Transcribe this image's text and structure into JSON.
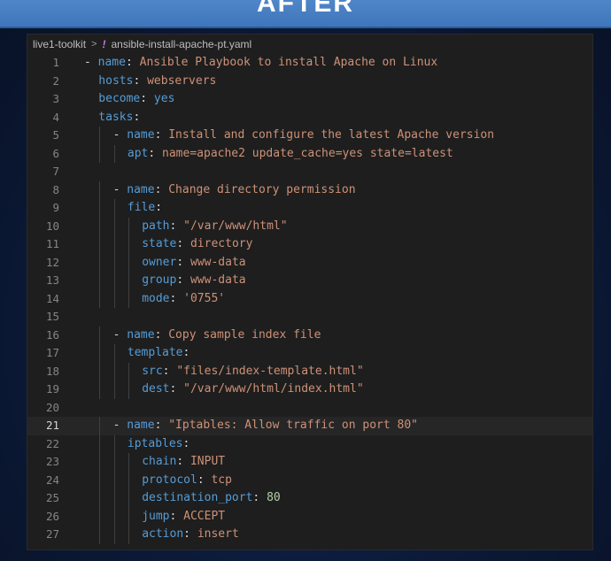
{
  "banner": {
    "title": "AFTER"
  },
  "breadcrumb": {
    "folder": "live1-toolkit",
    "separator": ">",
    "file_icon": "!",
    "file": "ansible-install-apache-pt.yaml"
  },
  "editor": {
    "active_line": 21,
    "lines": [
      {
        "n": "1",
        "indent": 0,
        "segs": [
          {
            "c": "d",
            "t": "- "
          },
          {
            "c": "k",
            "t": "name"
          },
          {
            "c": "p",
            "t": ": "
          },
          {
            "c": "v",
            "t": "Ansible Playbook to install Apache on Linux"
          }
        ]
      },
      {
        "n": "2",
        "indent": 1,
        "segs": [
          {
            "c": "k",
            "t": "hosts"
          },
          {
            "c": "p",
            "t": ": "
          },
          {
            "c": "v",
            "t": "webservers"
          }
        ]
      },
      {
        "n": "3",
        "indent": 1,
        "segs": [
          {
            "c": "k",
            "t": "become"
          },
          {
            "c": "p",
            "t": ": "
          },
          {
            "c": "k",
            "t": "yes"
          }
        ]
      },
      {
        "n": "4",
        "indent": 1,
        "segs": [
          {
            "c": "k",
            "t": "tasks"
          },
          {
            "c": "p",
            "t": ":"
          }
        ]
      },
      {
        "n": "5",
        "indent": 2,
        "segs": [
          {
            "c": "d",
            "t": "- "
          },
          {
            "c": "k",
            "t": "name"
          },
          {
            "c": "p",
            "t": ": "
          },
          {
            "c": "v",
            "t": "Install and configure the latest Apache version"
          }
        ]
      },
      {
        "n": "6",
        "indent": 3,
        "segs": [
          {
            "c": "k",
            "t": "apt"
          },
          {
            "c": "p",
            "t": ": "
          },
          {
            "c": "v",
            "t": "name=apache2 update_cache=yes state=latest"
          }
        ]
      },
      {
        "n": "7",
        "indent": 0,
        "segs": []
      },
      {
        "n": "8",
        "indent": 2,
        "segs": [
          {
            "c": "d",
            "t": "- "
          },
          {
            "c": "k",
            "t": "name"
          },
          {
            "c": "p",
            "t": ": "
          },
          {
            "c": "v",
            "t": "Change directory permission"
          }
        ]
      },
      {
        "n": "9",
        "indent": 3,
        "segs": [
          {
            "c": "k",
            "t": "file"
          },
          {
            "c": "p",
            "t": ":"
          }
        ]
      },
      {
        "n": "10",
        "indent": 4,
        "segs": [
          {
            "c": "k",
            "t": "path"
          },
          {
            "c": "p",
            "t": ": "
          },
          {
            "c": "v",
            "t": "\"/var/www/html\""
          }
        ]
      },
      {
        "n": "11",
        "indent": 4,
        "segs": [
          {
            "c": "k",
            "t": "state"
          },
          {
            "c": "p",
            "t": ": "
          },
          {
            "c": "v",
            "t": "directory"
          }
        ]
      },
      {
        "n": "12",
        "indent": 4,
        "segs": [
          {
            "c": "k",
            "t": "owner"
          },
          {
            "c": "p",
            "t": ": "
          },
          {
            "c": "v",
            "t": "www-data"
          }
        ]
      },
      {
        "n": "13",
        "indent": 4,
        "segs": [
          {
            "c": "k",
            "t": "group"
          },
          {
            "c": "p",
            "t": ": "
          },
          {
            "c": "v",
            "t": "www-data"
          }
        ]
      },
      {
        "n": "14",
        "indent": 4,
        "segs": [
          {
            "c": "k",
            "t": "mode"
          },
          {
            "c": "p",
            "t": ": "
          },
          {
            "c": "v",
            "t": "'0755'"
          }
        ]
      },
      {
        "n": "15",
        "indent": 0,
        "segs": []
      },
      {
        "n": "16",
        "indent": 2,
        "segs": [
          {
            "c": "d",
            "t": "- "
          },
          {
            "c": "k",
            "t": "name"
          },
          {
            "c": "p",
            "t": ": "
          },
          {
            "c": "v",
            "t": "Copy sample index file"
          }
        ]
      },
      {
        "n": "17",
        "indent": 3,
        "segs": [
          {
            "c": "k",
            "t": "template"
          },
          {
            "c": "p",
            "t": ":"
          }
        ]
      },
      {
        "n": "18",
        "indent": 4,
        "segs": [
          {
            "c": "k",
            "t": "src"
          },
          {
            "c": "p",
            "t": ": "
          },
          {
            "c": "v",
            "t": "\"files/index-template.html\""
          }
        ]
      },
      {
        "n": "19",
        "indent": 4,
        "segs": [
          {
            "c": "k",
            "t": "dest"
          },
          {
            "c": "p",
            "t": ": "
          },
          {
            "c": "v",
            "t": "\"/var/www/html/index.html\""
          }
        ]
      },
      {
        "n": "20",
        "indent": 0,
        "segs": []
      },
      {
        "n": "21",
        "indent": 2,
        "segs": [
          {
            "c": "d",
            "t": "- "
          },
          {
            "c": "k",
            "t": "name"
          },
          {
            "c": "p",
            "t": ": "
          },
          {
            "c": "v",
            "t": "\"Iptables: Allow traffic on port 80\""
          }
        ]
      },
      {
        "n": "22",
        "indent": 3,
        "segs": [
          {
            "c": "k",
            "t": "iptables"
          },
          {
            "c": "p",
            "t": ":"
          }
        ]
      },
      {
        "n": "23",
        "indent": 4,
        "segs": [
          {
            "c": "k",
            "t": "chain"
          },
          {
            "c": "p",
            "t": ": "
          },
          {
            "c": "v",
            "t": "INPUT"
          }
        ]
      },
      {
        "n": "24",
        "indent": 4,
        "segs": [
          {
            "c": "k",
            "t": "protocol"
          },
          {
            "c": "p",
            "t": ": "
          },
          {
            "c": "v",
            "t": "tcp"
          }
        ]
      },
      {
        "n": "25",
        "indent": 4,
        "segs": [
          {
            "c": "k",
            "t": "destination_port"
          },
          {
            "c": "p",
            "t": ": "
          },
          {
            "c": "n",
            "t": "80"
          }
        ]
      },
      {
        "n": "26",
        "indent": 4,
        "segs": [
          {
            "c": "k",
            "t": "jump"
          },
          {
            "c": "p",
            "t": ": "
          },
          {
            "c": "v",
            "t": "ACCEPT"
          }
        ]
      },
      {
        "n": "27",
        "indent": 4,
        "segs": [
          {
            "c": "k",
            "t": "action"
          },
          {
            "c": "p",
            "t": ": "
          },
          {
            "c": "v",
            "t": "insert"
          }
        ]
      }
    ]
  }
}
